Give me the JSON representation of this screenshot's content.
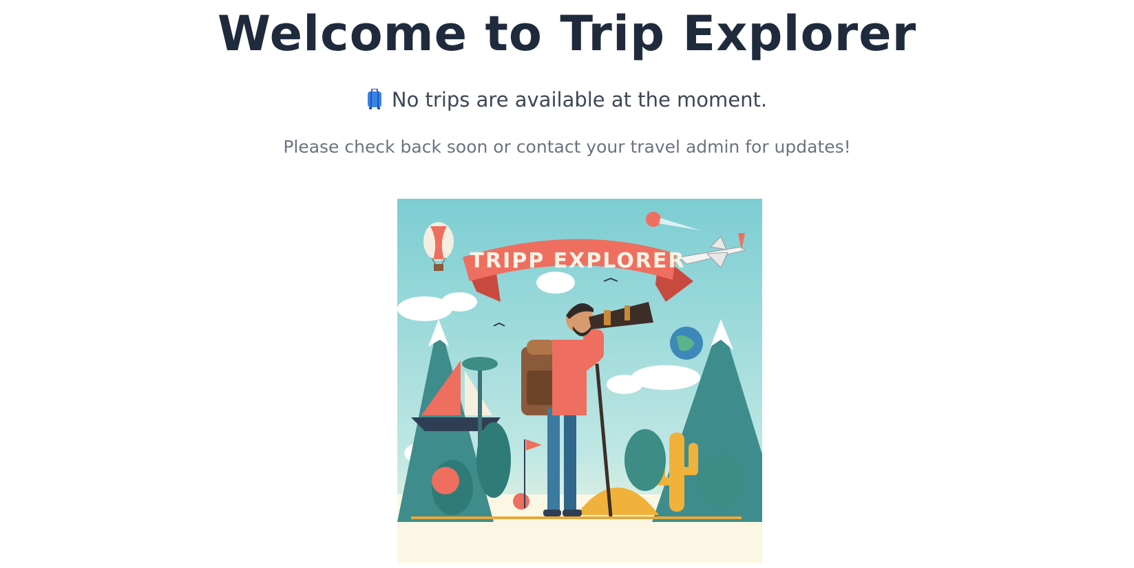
{
  "header": {
    "title": "Welcome to Trip Explorer"
  },
  "empty_state": {
    "icon": "suitcase-icon",
    "message": "No trips are available at the moment.",
    "submessage": "Please check back soon or contact your travel admin for updates!"
  },
  "hero_image": {
    "banner_text": "TRIPP EXPLORER",
    "colors": {
      "sky": "#8fd3d6",
      "ribbon": "#ee6f5f",
      "ground": "#fbf7e4",
      "mountain": "#3f8c8c",
      "cactus": "#f0b23a"
    }
  },
  "colors": {
    "title": "#1f2a3d",
    "message": "#3c4656",
    "submessage": "#6b7280"
  }
}
